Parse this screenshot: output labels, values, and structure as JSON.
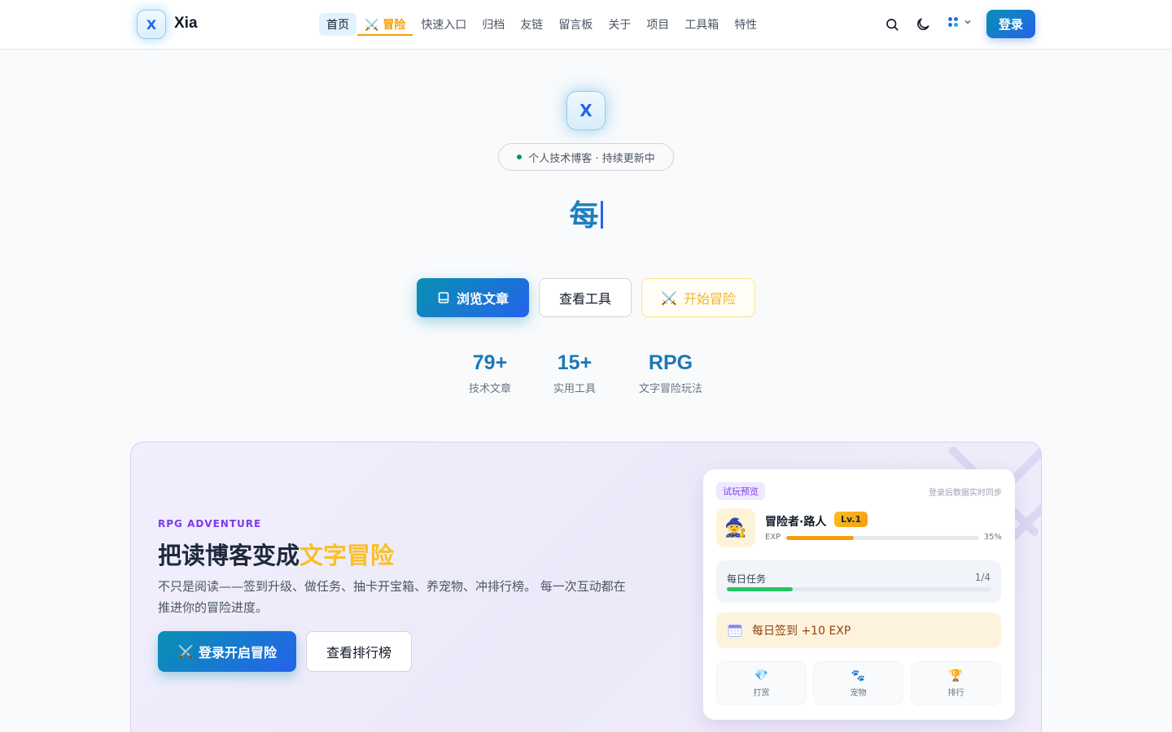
{
  "header": {
    "logo_letter": "X",
    "brand": "Xia",
    "nav": [
      {
        "label": "首页",
        "active": true
      },
      {
        "label": "冒险",
        "icon": "crossed-swords-icon",
        "adventure": true
      },
      {
        "label": "快速入口"
      },
      {
        "label": "归档"
      },
      {
        "label": "友链"
      },
      {
        "label": "留言板"
      },
      {
        "label": "关于"
      },
      {
        "label": "项目"
      },
      {
        "label": "工具箱"
      },
      {
        "label": "特性"
      }
    ],
    "login_label": "登录"
  },
  "hero": {
    "logo_letter": "X",
    "tagline": "个人技术博客 · 持续更新中",
    "typing_text": "每",
    "buttons": {
      "browse": "浏览文章",
      "tools": "查看工具",
      "adventure": "开始冒险"
    },
    "stats": [
      {
        "value": "79+",
        "label": "技术文章"
      },
      {
        "value": "15+",
        "label": "实用工具"
      },
      {
        "value": "RPG",
        "label": "文字冒险玩法"
      }
    ]
  },
  "rpg": {
    "kicker": "RPG ADVENTURE",
    "title_plain": "把读博客变成",
    "title_highlight": "文字冒险",
    "description": "不只是阅读——签到升级、做任务、抽卡开宝箱、养宠物、冲排行榜。 每一次互动都在推进你的冒险进度。",
    "login_button": "登录开启冒险",
    "leaderboard_button": "查看排行榜",
    "card": {
      "badge": "试玩预览",
      "sync_note": "登录后数据实时同步",
      "hero_name": "冒险者·路人",
      "level": "Lv.1",
      "exp_label": "EXP",
      "exp_percent_text": "35%",
      "exp_fraction": 0.35,
      "task_label": "每日任务",
      "task_count": "1/4",
      "task_fraction": 0.25,
      "checkin": "每日签到 +10 EXP",
      "tiles": [
        {
          "label": "打赏",
          "icon": "gem-icon"
        },
        {
          "label": "宠物",
          "icon": "paw-icon"
        },
        {
          "label": "排行",
          "icon": "trophy-icon"
        }
      ]
    }
  },
  "colors": {
    "accent": "#0891b2",
    "brand_blue": "#2563eb",
    "adventure_gold": "#f59e0b",
    "rpg_purple": "#7c3aed"
  }
}
